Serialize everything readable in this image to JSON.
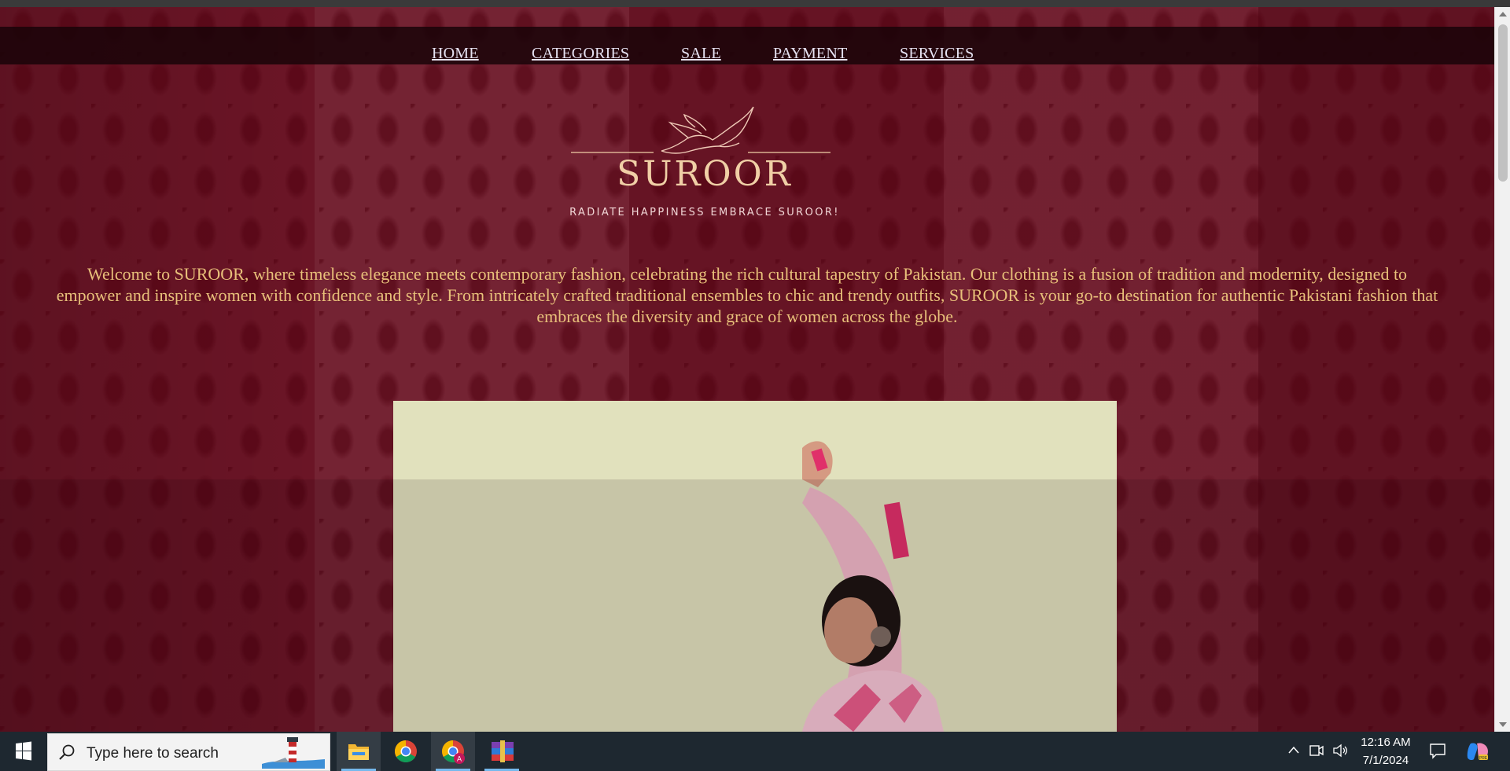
{
  "nav": {
    "items": [
      {
        "label": "HOME"
      },
      {
        "label": "CATEGORIES"
      },
      {
        "label": "SALE"
      },
      {
        "label": "PAYMENT"
      },
      {
        "label": "SERVICES"
      }
    ]
  },
  "logo": {
    "brand": "SUROOR",
    "tagline": "RADIATE HAPPINESS  EMBRACE SUROOR!"
  },
  "intro": {
    "text": "Welcome to SUROOR, where timeless elegance meets contemporary fashion, celebrating the rich cultural tapestry of Pakistan. Our clothing is a fusion of tradition and modernity, designed to empower and inspire women with confidence and style. From intricately crafted traditional ensembles to chic and trendy outfits, SUROOR is your go-to destination for authentic Pakistani fashion that embraces the diversity and grace of women across the globe."
  },
  "colors": {
    "background": "#6b1526",
    "navbar": "#19040a",
    "intro_text": "#e8c07a",
    "nav_text": "#e6e2f2",
    "logo": "#f0cfa6"
  },
  "taskbar": {
    "search_placeholder": "Type here to search",
    "apps": [
      {
        "icon": "file-explorer-icon"
      },
      {
        "icon": "chrome-icon"
      },
      {
        "icon": "chrome-profile-icon"
      },
      {
        "icon": "winrar-icon"
      }
    ],
    "clock": {
      "time": "12:16 AM",
      "date": "7/1/2024"
    }
  }
}
